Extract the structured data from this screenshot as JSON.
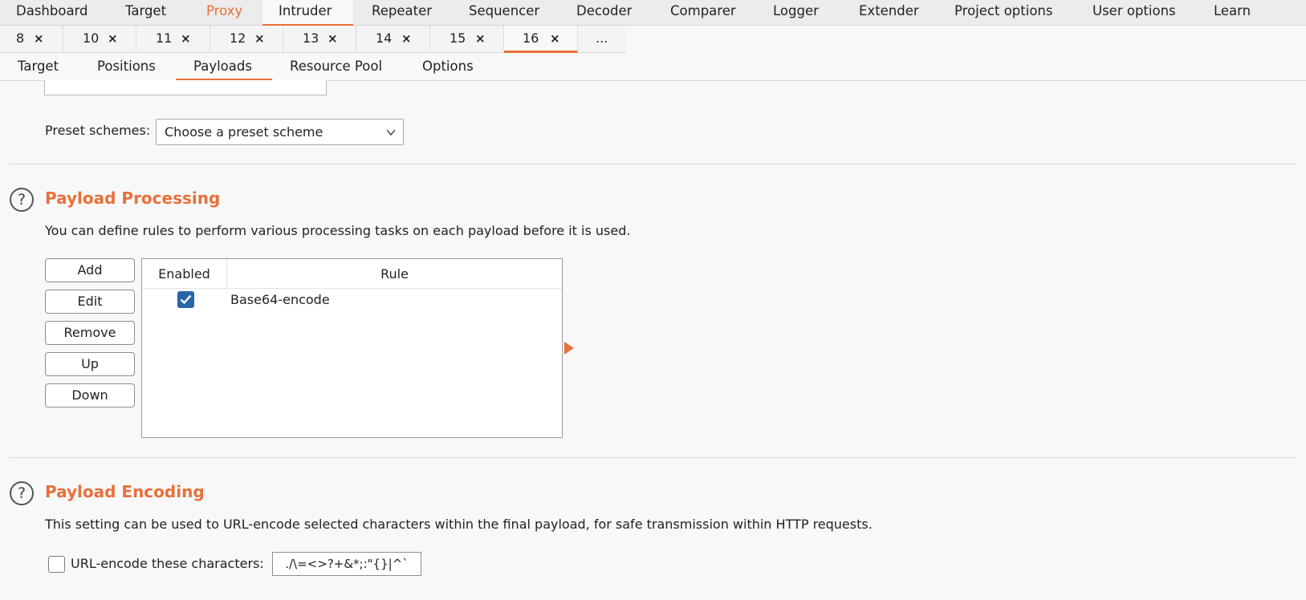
{
  "main_tabs": [
    {
      "label": "Dashboard"
    },
    {
      "label": "Target"
    },
    {
      "label": "Proxy"
    },
    {
      "label": "Intruder"
    },
    {
      "label": "Repeater"
    },
    {
      "label": "Sequencer"
    },
    {
      "label": "Decoder"
    },
    {
      "label": "Comparer"
    },
    {
      "label": "Logger"
    },
    {
      "label": "Extender"
    },
    {
      "label": "Project options"
    },
    {
      "label": "User options"
    },
    {
      "label": "Learn"
    }
  ],
  "active_main_tab": "Intruder",
  "request_tabs": [
    {
      "num": "8",
      "close": "×"
    },
    {
      "num": "10",
      "close": "×"
    },
    {
      "num": "11",
      "close": "×"
    },
    {
      "num": "12",
      "close": "×"
    },
    {
      "num": "13",
      "close": "×"
    },
    {
      "num": "14",
      "close": "×"
    },
    {
      "num": "15",
      "close": "×"
    },
    {
      "num": "16",
      "close": "×"
    }
  ],
  "request_tabs_more": "...",
  "active_request_tab": "16",
  "sub_tabs": [
    {
      "label": "Target"
    },
    {
      "label": "Positions"
    },
    {
      "label": "Payloads"
    },
    {
      "label": "Resource Pool"
    },
    {
      "label": "Options"
    }
  ],
  "active_sub_tab": "Payloads",
  "preset": {
    "label": "Preset schemes:",
    "value": "Choose a preset scheme"
  },
  "processing": {
    "help": "?",
    "title": "Payload Processing",
    "description": "You can define rules to perform various processing tasks on each payload before it is used.",
    "buttons": {
      "add": "Add",
      "edit": "Edit",
      "remove": "Remove",
      "up": "Up",
      "down": "Down"
    },
    "table": {
      "headers": {
        "enabled": "Enabled",
        "rule": "Rule"
      },
      "rows": [
        {
          "enabled": true,
          "rule": "Base64-encode"
        }
      ]
    }
  },
  "encoding": {
    "help": "?",
    "title": "Payload Encoding",
    "description": "This setting can be used to URL-encode selected characters within the final payload, for safe transmission within HTTP requests.",
    "checkbox_label": "URL-encode these characters:",
    "checked": false,
    "characters": "./\\=<>?+&*;:\"{}|^`"
  },
  "colors": {
    "accent": "#e8703a",
    "checkbox": "#2a65a8"
  }
}
